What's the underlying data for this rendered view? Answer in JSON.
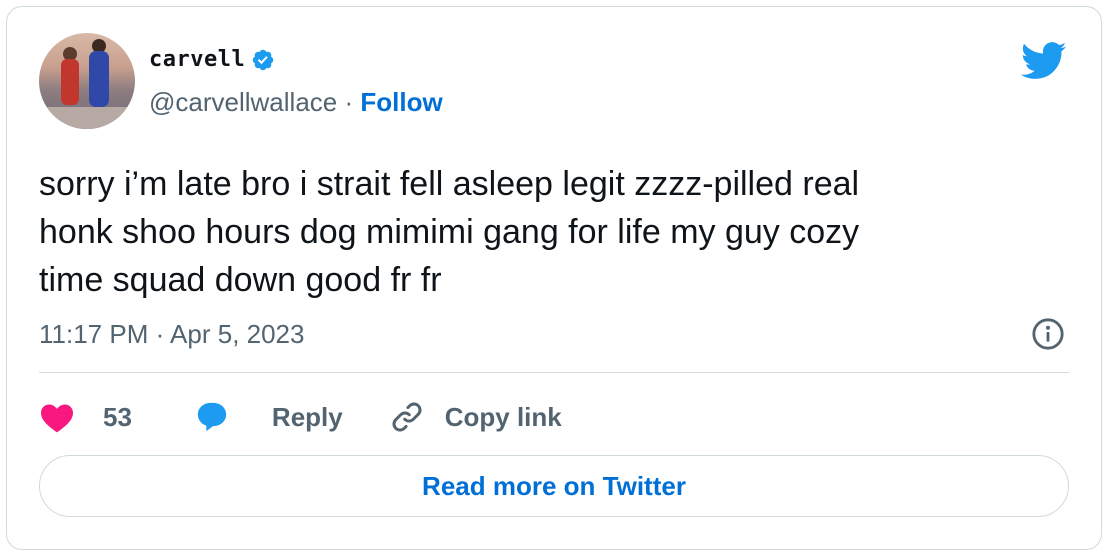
{
  "author": {
    "display_name": "carvell",
    "handle": "@carvellwallace",
    "separator": "·",
    "follow_label": "Follow"
  },
  "tweet": {
    "text_lines": [
      "sorry i’m late bro i strait fell asleep legit zzzz-pilled real",
      "honk shoo hours dog mimimi gang for life my guy cozy",
      "time squad down good fr fr"
    ],
    "time": "11:17 PM",
    "date_separator": "·",
    "date": "Apr 5, 2023"
  },
  "actions": {
    "likes_count": "53",
    "reply_label": "Reply",
    "copy_link_label": "Copy link"
  },
  "read_more_label": "Read more on Twitter",
  "colors": {
    "accent_blue": "#1d9bf0",
    "link_blue": "#006fd6",
    "heart_red": "#f91880",
    "text_primary": "#0f1419",
    "text_secondary": "#536471",
    "border": "#cfd9de"
  },
  "icons": {
    "verified": "verified-badge-icon",
    "brand": "twitter-bird-icon",
    "info": "info-icon",
    "like": "heart-icon",
    "reply": "speech-bubble-icon",
    "copy": "link-icon"
  }
}
